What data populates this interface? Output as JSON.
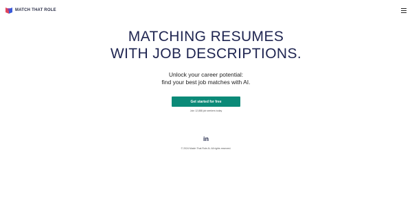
{
  "header": {
    "brand": "MATCH THAT ROLE",
    "logo_icon": "match-that-role-logo",
    "menu_icon": "hamburger-menu-icon"
  },
  "hero": {
    "title_line1": "MATCHING RESUMES",
    "title_line2": "WITH JOB DESCRIPTIONS.",
    "subtitle_line1": "Unlock your career potential:",
    "subtitle_line2": "find your best job matches with AI."
  },
  "cta": {
    "label": "Get started for free",
    "join_text": "Join 12,888 job seekers today",
    "color": "#0b8a78"
  },
  "footer": {
    "social": "in",
    "social_icon": "linkedin-icon",
    "copyright": "© 2024 Match That Role AI. All rights reserved."
  },
  "colors": {
    "title": "#1e2450",
    "button": "#0b8a78",
    "logo_red": "#e0465b",
    "logo_blue": "#3a5bd9",
    "logo_purple": "#7b3fb0"
  }
}
